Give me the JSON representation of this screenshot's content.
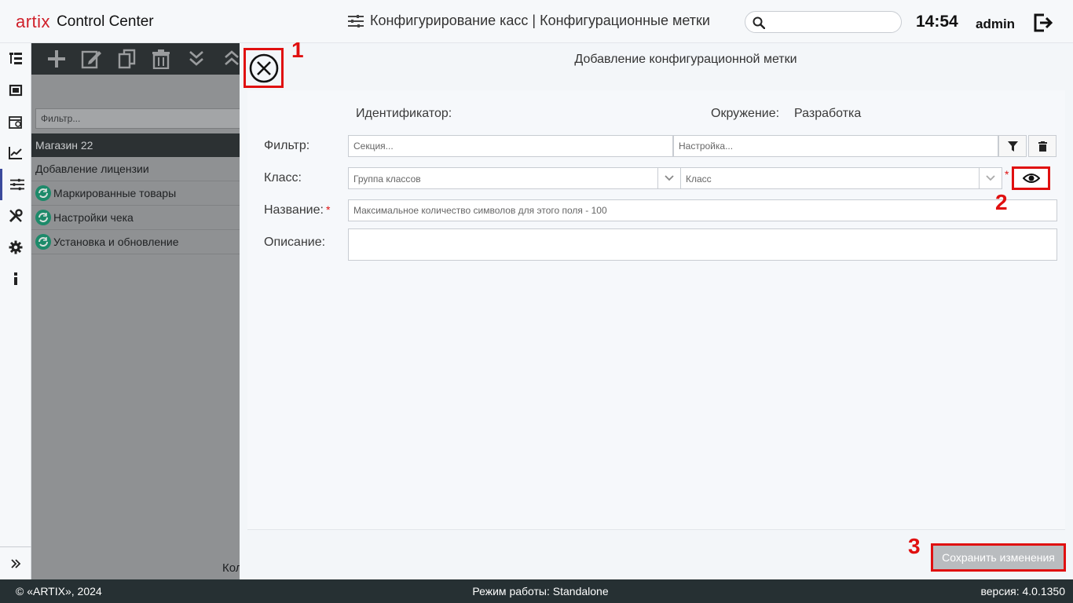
{
  "header": {
    "logo_brand": "artix",
    "logo_product": "Control Center",
    "page_title": "Конфигурирование касс | Конфигурационные метки",
    "search_placeholder": "",
    "clock": "14:54",
    "user": "admin"
  },
  "rail": {
    "icons": [
      "tree-icon",
      "cashbox-icon",
      "calendar-icon",
      "chart-icon",
      "sliders-icon",
      "tools-icon",
      "gear-icon",
      "info-icon"
    ],
    "active_index": 4
  },
  "under_panel": {
    "filter_placeholder": "Фильтр...",
    "group": "Магазин 22",
    "rows": [
      {
        "label": "Добавление лицензии",
        "synced": false
      },
      {
        "label": "Маркированные товары",
        "synced": true
      },
      {
        "label": "Настройки чека",
        "synced": true
      },
      {
        "label": "Установка и обновление",
        "synced": true
      }
    ],
    "bottom_text": "Кол"
  },
  "dialog": {
    "title": "Добавление конфигурационной метки",
    "identifier_label": "Идентификатор:",
    "identifier_value": "",
    "environment_label": "Окружение:",
    "environment_value": "Разработка",
    "filter_label": "Фильтр:",
    "section_placeholder": "Секция...",
    "setting_placeholder": "Настройка...",
    "class_label": "Класс:",
    "class_group_placeholder": "Группа классов",
    "class_placeholder": "Класс",
    "required_mark": "*",
    "name_label": "Название:",
    "name_placeholder": "Максимальное количество символов для этого поля - 100",
    "description_label": "Описание:",
    "save_label": "Сохранить изменения"
  },
  "annotations": [
    "1",
    "2",
    "3"
  ],
  "footer": {
    "copyright": "© «ARTIX», 2024",
    "mode": "Режим работы: Standalone",
    "version": "версия: 4.0.1350"
  },
  "colors": {
    "brand_red": "#d0202a",
    "annotation_red": "#e01010",
    "active_rail": "#3b4a9c",
    "footer_bg": "#263033",
    "sync_green": "#1d8a6a"
  }
}
